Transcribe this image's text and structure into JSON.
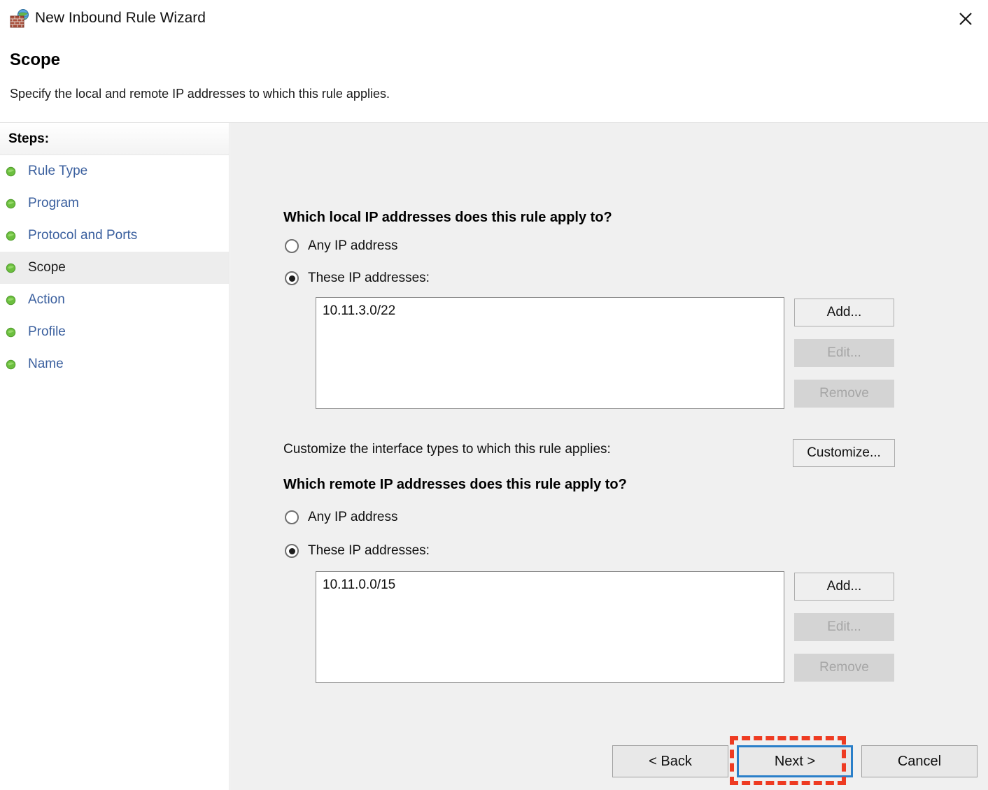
{
  "window": {
    "title": "New Inbound Rule Wizard",
    "icon": "firewall-globe-icon",
    "close_label": "✕"
  },
  "header": {
    "page_title": "Scope",
    "subtitle": "Specify the local and remote IP addresses to which this rule applies."
  },
  "sidebar": {
    "header": "Steps:",
    "items": [
      {
        "label": "Rule Type",
        "current": false
      },
      {
        "label": "Program",
        "current": false
      },
      {
        "label": "Protocol and Ports",
        "current": false
      },
      {
        "label": "Scope",
        "current": true
      },
      {
        "label": "Action",
        "current": false
      },
      {
        "label": "Profile",
        "current": false
      },
      {
        "label": "Name",
        "current": false
      }
    ]
  },
  "main": {
    "local": {
      "heading": "Which local IP addresses does this rule apply to?",
      "radio_any_label": "Any IP address",
      "radio_any_selected": false,
      "radio_these_label": "These IP addresses:",
      "radio_these_selected": true,
      "entries": [
        "10.11.3.0/22"
      ],
      "add_label": "Add...",
      "edit_label": "Edit...",
      "remove_label": "Remove"
    },
    "interface": {
      "label": "Customize the interface types to which this rule applies:",
      "customize_label": "Customize..."
    },
    "remote": {
      "heading": "Which remote IP addresses does this rule apply to?",
      "radio_any_label": "Any IP address",
      "radio_any_selected": false,
      "radio_these_label": "These IP addresses:",
      "radio_these_selected": true,
      "entries": [
        "10.11.0.0/15"
      ],
      "add_label": "Add...",
      "edit_label": "Edit...",
      "remove_label": "Remove"
    }
  },
  "footer": {
    "back_label": "< Back",
    "next_label": "Next >",
    "cancel_label": "Cancel",
    "next_focused": true,
    "annotation_target": "next-button"
  },
  "colors": {
    "accent_blue": "#2a7fc9",
    "annotation_red": "#ee3b22",
    "step_link": "#3a5f9e",
    "content_bg": "#f0f0f0",
    "step_bullet_green": "#5cb034"
  }
}
